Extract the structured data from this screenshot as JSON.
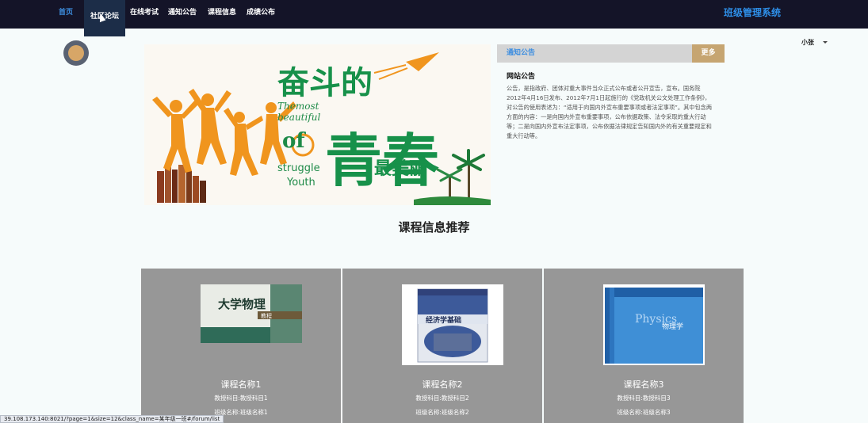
{
  "nav": {
    "items": [
      {
        "label": "首页",
        "active": true
      },
      {
        "label": "社区论坛",
        "hover": true
      },
      {
        "label": "在线考试"
      },
      {
        "label": "通知公告"
      },
      {
        "label": "课程信息"
      },
      {
        "label": "成绩公布"
      }
    ],
    "brand": "班级管理系统"
  },
  "user": {
    "name": "小张"
  },
  "banner": {
    "title_top": "奋斗的",
    "title_big": "青春",
    "title_small": "最美丽",
    "english_lines": [
      "Themost",
      "beautiful",
      "of",
      "struggle",
      "Youth"
    ]
  },
  "notice": {
    "header": "通知公告",
    "more": "更多",
    "heading": "网站公告",
    "body": "公告，是指政府、团体对重大事件当众正式公布或者公开宣告，宣布。国务院2012年4月16日发布、2012年7月1日起施行的《党政机关公文处理工作条例》，对公告的使用表述为：“适用于向国内外宣布重要事项或者法定事项”。其中包含两方面的内容：一是向国内外宣布重要事项，公布依据政策、法令采取的重大行动等；二是向国内外宣布法定事项，公布依据法律规定告知国内外的有关重要规定和重大行动等。"
  },
  "section": {
    "title": "课程信息推荐"
  },
  "courses": [
    {
      "name": "课程名称1",
      "subject": "教授科目:教授科目1",
      "class": "班级名称:班级名称1",
      "cover_title": "大学物理",
      "cover_sub": "教程"
    },
    {
      "name": "课程名称2",
      "subject": "教授科目:教授科目2",
      "class": "班级名称:班级名称2",
      "cover_title": "经济学基础"
    },
    {
      "name": "课程名称3",
      "subject": "教授科目:教授科目3",
      "class": "班级名称:班级名称3",
      "cover_title": "物理学",
      "cover_en": "Physics"
    }
  ],
  "status_url": "39.108.173.140:8021/?page=1&size=12&class_name=某年级一班#/forum/list"
}
